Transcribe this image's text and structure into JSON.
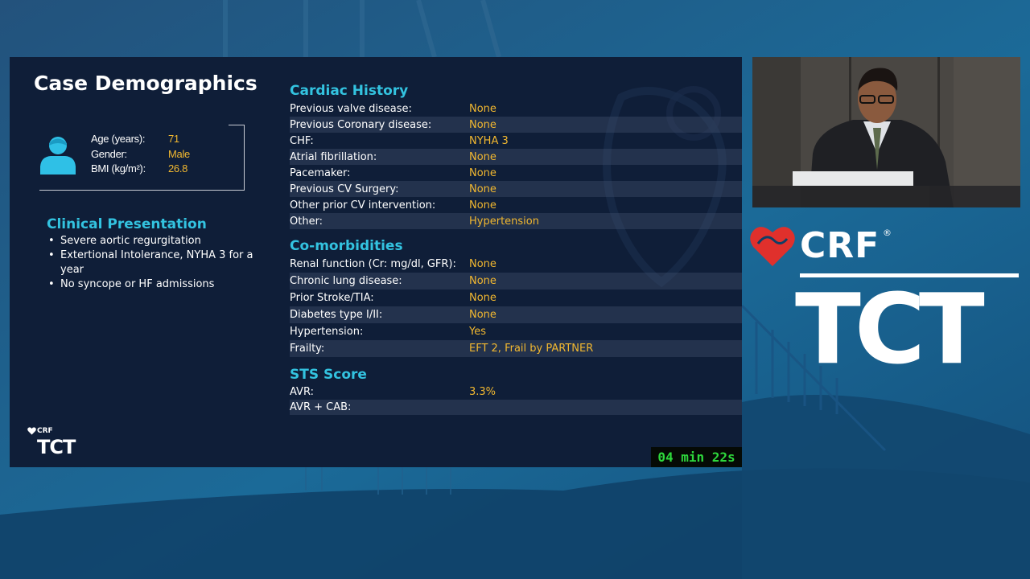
{
  "slide": {
    "title": "Case Demographics",
    "demographics": [
      {
        "label": "Age (years):",
        "value": "71"
      },
      {
        "label": "Gender:",
        "value": "Male"
      },
      {
        "label": "BMI (kg/m²):",
        "value": "26.8"
      }
    ],
    "clinical_presentation": {
      "heading": "Clinical Presentation",
      "items": [
        "Severe aortic regurgitation",
        "Extertional Intolerance, NYHA 3 for a year",
        "No syncope or HF admissions"
      ]
    },
    "cardiac_history": {
      "heading": "Cardiac History",
      "rows": [
        {
          "label": "Previous valve disease:",
          "value": "None"
        },
        {
          "label": "Previous Coronary disease:",
          "value": "None"
        },
        {
          "label": "CHF:",
          "value": "NYHA 3"
        },
        {
          "label": "Atrial fibrillation:",
          "value": "None"
        },
        {
          "label": "Pacemaker:",
          "value": "None"
        },
        {
          "label": "Previous CV Surgery:",
          "value": "None"
        },
        {
          "label": "Other prior CV intervention:",
          "value": "None"
        },
        {
          "label": "Other:",
          "value": "Hypertension"
        }
      ]
    },
    "comorbidities": {
      "heading": "Co-morbidities",
      "rows": [
        {
          "label": "Renal function (Cr: mg/dl, GFR):",
          "value": "None"
        },
        {
          "label": "Chronic lung disease:",
          "value": "None"
        },
        {
          "label": "Prior Stroke/TIA:",
          "value": "None"
        },
        {
          "label": "Diabetes type I/II:",
          "value": "None"
        },
        {
          "label": "Hypertension:",
          "value": "Yes"
        },
        {
          "label": "Frailty:",
          "value": "EFT 2, Frail by PARTNER"
        }
      ]
    },
    "sts_score": {
      "heading": "STS Score",
      "rows": [
        {
          "label": "AVR:",
          "value": "3.3%"
        },
        {
          "label": "AVR + CAB:",
          "value": ""
        }
      ]
    },
    "small_logo": {
      "crf": "CRF",
      "tct": "TCT"
    }
  },
  "timer": "04 min 22s",
  "brand": {
    "crf": "CRF",
    "registered": "®",
    "tct": "TCT"
  },
  "colors": {
    "accent_cyan": "#33c3e0",
    "value_gold": "#f2b830",
    "heart_red": "#e0302c",
    "timer_green": "#2ed93c",
    "slide_bg": "#0f1e38"
  }
}
